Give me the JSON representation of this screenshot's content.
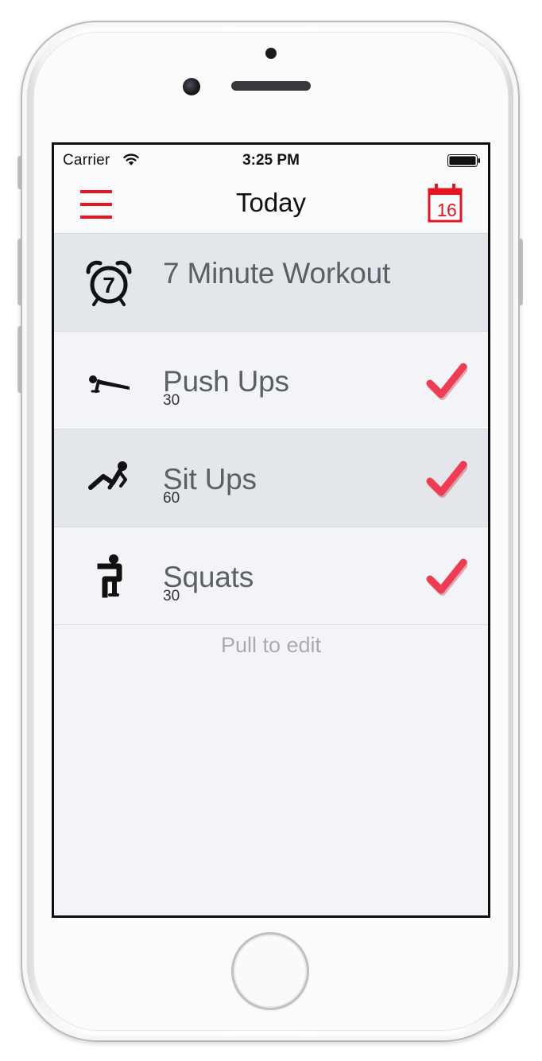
{
  "status_bar": {
    "carrier": "Carrier",
    "time": "3:25 PM"
  },
  "nav": {
    "title": "Today",
    "menu_icon": "hamburger-menu-icon",
    "calendar_icon": "calendar-icon",
    "calendar_day": "16"
  },
  "workouts": [
    {
      "title": "7 Minute Workout",
      "icon": "alarm-clock-7-icon"
    },
    {
      "title": "Push Ups",
      "count": "30",
      "icon": "push-up-icon",
      "done": true
    },
    {
      "title": "Sit Ups",
      "count": "60",
      "icon": "sit-up-icon",
      "done": true
    },
    {
      "title": "Squats",
      "count": "30",
      "icon": "squat-icon",
      "done": true
    }
  ],
  "footer_hint": "Pull to edit",
  "colors": {
    "accent_red": "#e8141e",
    "check_red": "#f03c52",
    "row_alt_bg": "#e3e6ea",
    "row_bg": "#f3f4f7"
  }
}
